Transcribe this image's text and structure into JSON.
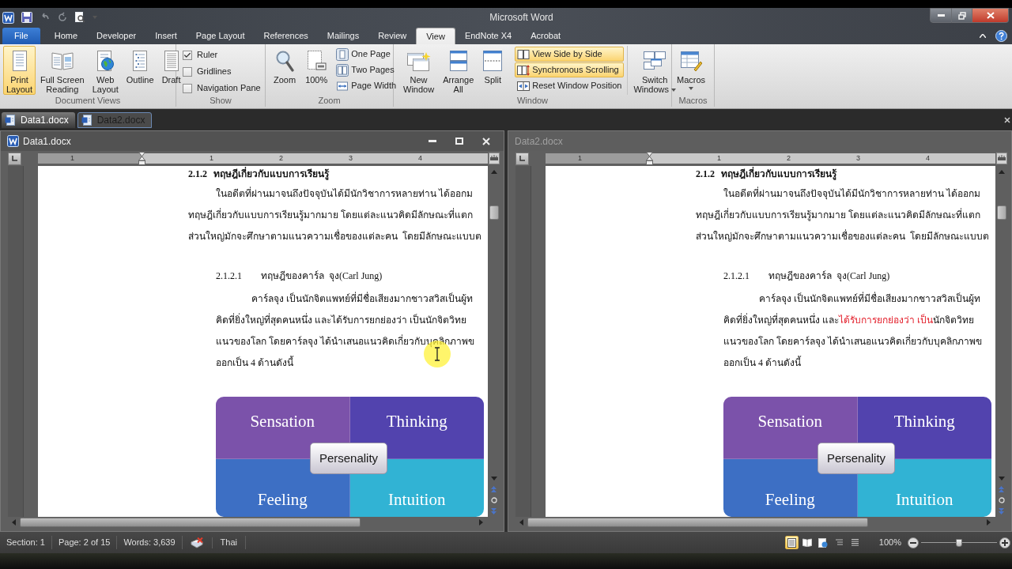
{
  "title_bar": {
    "title": "Microsoft Word",
    "quick_access": [
      {
        "disabled": false
      },
      {
        "disabled": true
      },
      {
        "disabled": true
      },
      {
        "disabled": false
      }
    ]
  },
  "ribbon_tabs": [
    {
      "label": "File",
      "kind": "file",
      "selected": false
    },
    {
      "label": "Home",
      "kind": "tab",
      "selected": false
    },
    {
      "label": "Developer",
      "kind": "tab",
      "selected": false
    },
    {
      "label": "Insert",
      "kind": "tab",
      "selected": false
    },
    {
      "label": "Page Layout",
      "kind": "tab",
      "selected": false
    },
    {
      "label": "References",
      "kind": "tab",
      "selected": false
    },
    {
      "label": "Mailings",
      "kind": "tab",
      "selected": false
    },
    {
      "label": "Review",
      "kind": "tab",
      "selected": false
    },
    {
      "label": "View",
      "kind": "tab",
      "selected": true
    },
    {
      "label": "EndNote X4",
      "kind": "tab",
      "selected": false
    },
    {
      "label": "Acrobat",
      "kind": "tab",
      "selected": false
    }
  ],
  "document_views": {
    "title": "Document Views",
    "buttons": [
      {
        "lines": [
          "Print",
          "Layout"
        ],
        "selected": true
      },
      {
        "lines": [
          "Full Screen",
          "Reading"
        ],
        "selected": false
      },
      {
        "lines": [
          "Web",
          "Layout"
        ],
        "selected": false
      },
      {
        "lines": [
          "Outline"
        ],
        "selected": false
      },
      {
        "lines": [
          "Draft"
        ],
        "selected": false
      }
    ]
  },
  "show": {
    "title": "Show",
    "options": [
      {
        "label": "Ruler",
        "checked": true
      },
      {
        "label": "Gridlines",
        "checked": false
      },
      {
        "label": "Navigation Pane",
        "checked": false
      }
    ]
  },
  "zoom": {
    "title": "Zoom",
    "large_buttons": [
      {
        "label": "Zoom"
      },
      {
        "label": "100%"
      }
    ],
    "small_buttons": [
      {
        "label": "One Page"
      },
      {
        "label": "Two Pages"
      },
      {
        "label": "Page Width"
      }
    ]
  },
  "window_group": {
    "title": "Window",
    "large_buttons": [
      {
        "lines": [
          "New",
          "Window"
        ]
      },
      {
        "lines": [
          "Arrange",
          "All"
        ]
      },
      {
        "lines": [
          "Split"
        ]
      }
    ],
    "small_buttons": [
      {
        "label": "View Side by Side",
        "selected": true
      },
      {
        "label": "Synchronous Scrolling",
        "selected": true
      },
      {
        "label": "Reset Window Position",
        "selected": false
      }
    ],
    "switch_button": {
      "lines": [
        "Switch",
        "Windows"
      ]
    }
  },
  "macros": {
    "title": "Macros",
    "button": {
      "label": "Macros"
    }
  },
  "document_tabs": [
    {
      "label": "Data1.docx",
      "selected": true
    },
    {
      "label": "Data2.docx",
      "selected": false
    }
  ],
  "doc_windows": [
    {
      "title": "Data1.docx",
      "active": true,
      "cursor_highlight": true,
      "ruler": {
        "labels": [
          "1",
          "1",
          "2",
          "3",
          "4"
        ]
      },
      "heading": {
        "number": "2.1.2",
        "text": "ทฤษฎีเกี่ยวกับแบบการเรียนรู้"
      },
      "paragraph": [
        "ในอดีตที่ผ่านมาจนถึงปัจจุบันได้มีนักวิชาการหลายท่าน ได้ออกม",
        "ทฤษฎีเกี่ยวกับแบบการเรียนรู้มากมาย โดยแต่ละแนวคิดมีลักษณะที่แตก",
        "ส่วนใหญ่มักจะศึกษาตามแนวความเชื่อของแต่ละคน  โดยมีลักษณะแบบต"
      ],
      "subheading": {
        "number": "2.1.2.1",
        "text": "ทฤษฎีของคาร์ล  จุง(Carl Jung)"
      },
      "body": [
        [
          {
            "text": "คาร์ลจุง เป็นนักจิตแพทย์ที่มีชื่อเสียงมากชาวสวิสเป็นผู้ท",
            "marked": false
          }
        ],
        [
          {
            "text": "คิดที่ยิ่งใหญ่ที่สุดคนหนึ่ง และได้รับการยกย่องว่า เป็นนักจิตวิทย",
            "marked": false
          }
        ],
        [
          {
            "text": "แนวของโลก โดยคาร์ลจุง ได้นำเสนอแนวคิดเกี่ยวกับบุคลิกภาพข",
            "marked": false
          }
        ],
        [
          {
            "text": "ออกเป็น 4 ด้านดังนี้",
            "marked": false
          }
        ]
      ],
      "diagram": {
        "quadrants": [
          {
            "label": "Sensation",
            "color": "#7b52aa"
          },
          {
            "label": "Thinking",
            "color": "#5243ae"
          },
          {
            "label": "Feeling",
            "color": "#3d6fc4"
          },
          {
            "label": "Intuition",
            "color": "#31b3d4"
          }
        ],
        "center": "Persenality"
      }
    },
    {
      "title": "Data2.docx",
      "active": false,
      "cursor_highlight": false,
      "ruler": {
        "labels": [
          "1",
          "1",
          "2",
          "3",
          "4"
        ]
      },
      "heading": {
        "number": "2.1.2",
        "text": "ทฤษฎีเกี่ยวกับแบบการเรียนรู้"
      },
      "paragraph": [
        "ในอดีตที่ผ่านมาจนถึงปัจจุบันได้มีนักวิชาการหลายท่าน ได้ออกม",
        "ทฤษฎีเกี่ยวกับแบบการเรียนรู้มากมาย โดยแต่ละแนวคิดมีลักษณะที่แตก",
        "ส่วนใหญ่มักจะศึกษาตามแนวความเชื่อของแต่ละคน  โดยมีลักษณะแบบต"
      ],
      "subheading": {
        "number": "2.1.2.1",
        "text": "ทฤษฎีของคาร์ล  จุง(Carl Jung)"
      },
      "body": [
        [
          {
            "text": "คาร์ลจุง เป็นนักจิตแพทย์ที่มีชื่อเสียงมากชาวสวิสเป็นผู้ท",
            "marked": false
          }
        ],
        [
          {
            "text": "คิดที่ยิ่งใหญ่ที่สุดคนหนึ่ง และ",
            "marked": false
          },
          {
            "text": "ได้รับการยกย่องว่า เป็น",
            "marked": true
          },
          {
            "text": "นักจิตวิทย",
            "marked": false
          }
        ],
        [
          {
            "text": "แนวของโลก โดยคาร์ลจุง ได้นำเสนอแนวคิดเกี่ยวกับบุคลิกภาพข",
            "marked": false
          }
        ],
        [
          {
            "text": "ออกเป็น 4 ด้านดังนี้",
            "marked": false
          }
        ]
      ],
      "diagram": {
        "quadrants": [
          {
            "label": "Sensation",
            "color": "#7b52aa"
          },
          {
            "label": "Thinking",
            "color": "#5243ae"
          },
          {
            "label": "Feeling",
            "color": "#3d6fc4"
          },
          {
            "label": "Intuition",
            "color": "#31b3d4"
          }
        ],
        "center": "Persenality"
      }
    }
  ],
  "status_bar": {
    "section": "Section: 1",
    "page": "Page: 2 of 15",
    "words": "Words: 3,639",
    "language": "Thai",
    "view_buttons": [
      {
        "selected": true
      },
      {
        "selected": false
      },
      {
        "selected": false
      },
      {
        "selected": false
      },
      {
        "selected": false
      }
    ],
    "zoom_label": "100%",
    "zoom_slider": {
      "level": 0.5
    }
  }
}
